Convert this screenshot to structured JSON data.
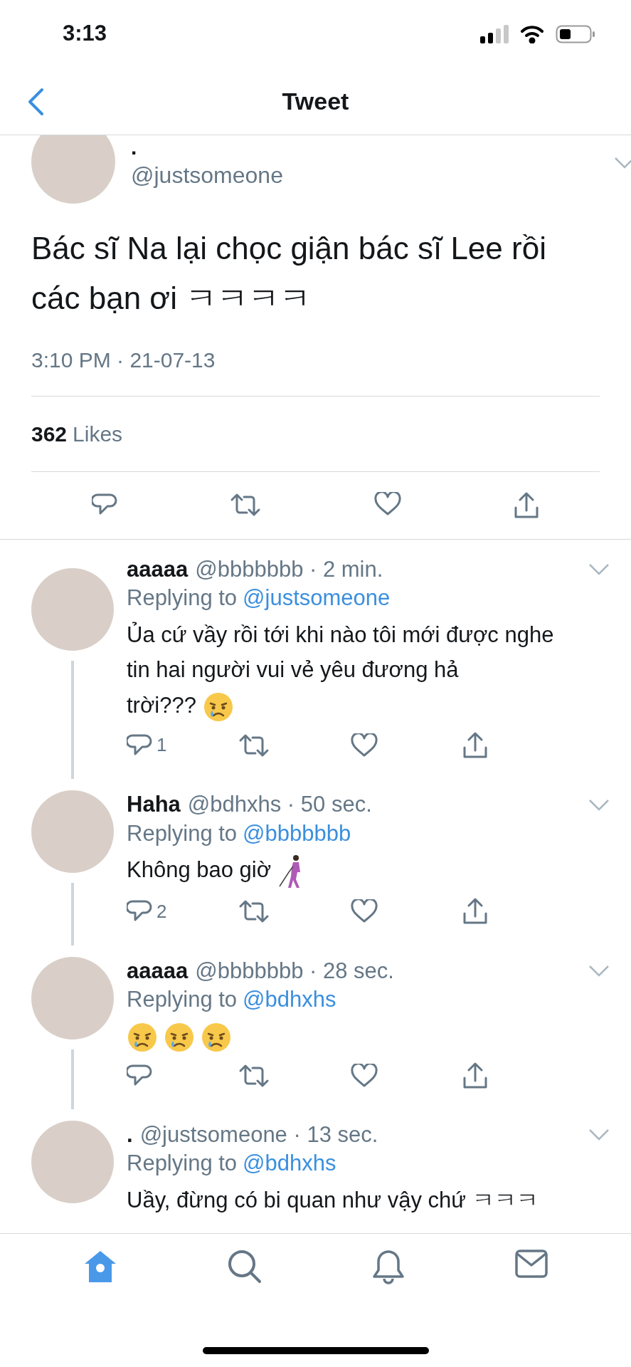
{
  "status_bar": {
    "time": "3:13"
  },
  "header": {
    "title": "Tweet"
  },
  "tweet": {
    "name": ".",
    "handle": "@justsomeone",
    "text": "Bác sĩ Na lại chọc giận bác sĩ Lee rồi các bạn ơi ㅋㅋㅋㅋ",
    "timestamp": "3:10 PM · 21-07-13",
    "likes_count": "362",
    "likes_label": "Likes"
  },
  "replies": [
    {
      "name": "aaaaa",
      "meta": "@bbbbbbb · 2 min.",
      "replying_label": "Replying to",
      "replying_to": "@justsomeone",
      "body": [
        {
          "kind": "paragraph",
          "text": "Ủa cứ vầy rồi tới khi nào tôi mới được nghe tin hai người vui vẻ yêu đương hả"
        },
        {
          "kind": "text",
          "text": "trời???"
        },
        {
          "kind": "crying_face"
        }
      ],
      "reply_count": "1",
      "thread_below": true,
      "actions_visible": true
    },
    {
      "name": "Haha",
      "meta": "@bdhxhs · 50 sec.",
      "replying_label": "Replying to",
      "replying_to": "@bbbbbbb",
      "body": [
        {
          "kind": "text",
          "text": "Không bao giờ"
        },
        {
          "kind": "person_with_cane"
        }
      ],
      "reply_count": "2",
      "thread_below": true,
      "actions_visible": true
    },
    {
      "name": "aaaaa",
      "meta": "@bbbbbbb · 28 sec.",
      "replying_label": "Replying to",
      "replying_to": "@bdhxhs",
      "body": [
        {
          "kind": "crying_face"
        },
        {
          "kind": "crying_face"
        },
        {
          "kind": "crying_face"
        }
      ],
      "thread_below": true,
      "actions_visible": true
    },
    {
      "name": ".",
      "meta": "@justsomeone · 13 sec.",
      "replying_label": "Replying to",
      "replying_to": "@bdhxhs",
      "body": [
        {
          "kind": "text",
          "text": "Uầy, đừng có bi quan như vậy chứ ㅋㅋㅋ"
        }
      ],
      "thread_below": false,
      "actions_visible": false
    }
  ],
  "tab_bar": [
    {
      "kind": "home",
      "selected": true
    },
    {
      "kind": "search",
      "selected": false
    },
    {
      "kind": "notifications",
      "selected": false
    },
    {
      "kind": "messages",
      "selected": false
    }
  ]
}
